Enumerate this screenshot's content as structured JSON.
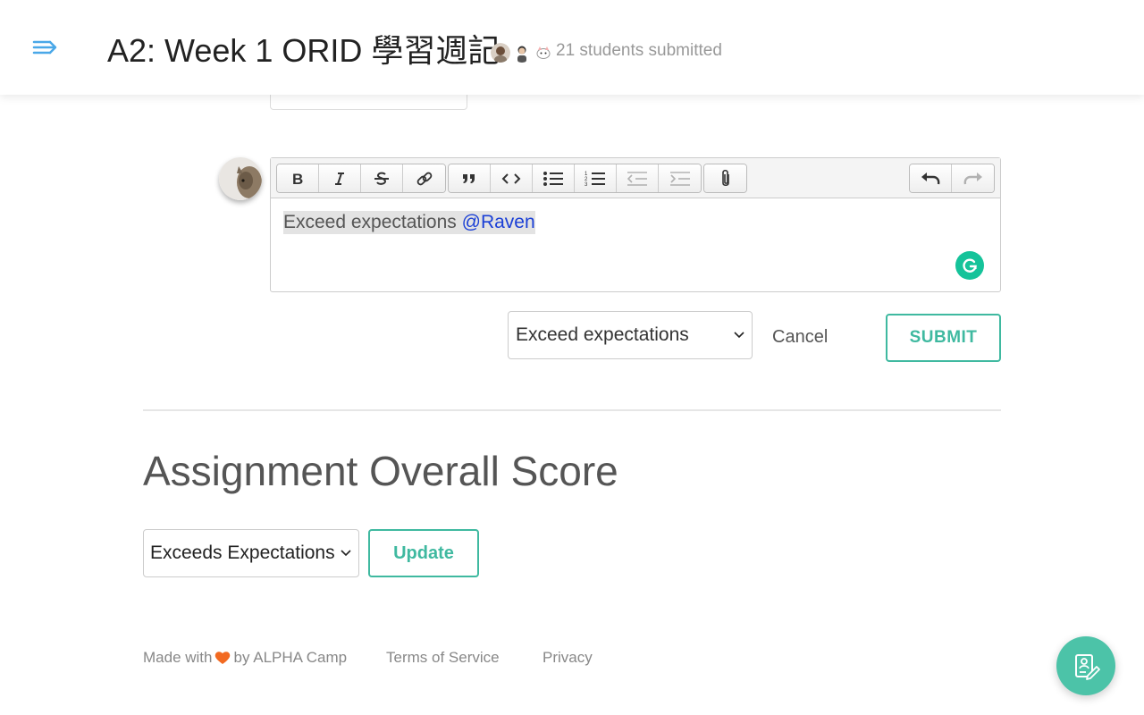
{
  "header": {
    "title": "A2: Week 1 ORID 學習週記",
    "submitted_text": "21 students submitted",
    "menu_icon": "menu-expand-icon"
  },
  "editor": {
    "content_text": "Exceed expectations",
    "mention": "@Raven",
    "toolbar": {
      "groups": [
        [
          "bold-icon",
          "italic-icon",
          "strikethrough-icon",
          "link-icon"
        ],
        [
          "quote-icon",
          "code-icon",
          "bullet-list-icon",
          "numbered-list-icon",
          "outdent-icon",
          "indent-icon"
        ],
        [
          "attach-icon"
        ],
        [
          "undo-icon",
          "redo-icon"
        ]
      ]
    }
  },
  "comment_form": {
    "rating_selected": "Exceed expectations",
    "cancel_label": "Cancel",
    "submit_label": "SUBMIT"
  },
  "overall": {
    "title": "Assignment Overall Score",
    "score_selected": "Exceeds Expectations",
    "update_label": "Update"
  },
  "footer": {
    "made_with": "Made with",
    "by": "by ALPHA Camp",
    "terms": "Terms of Service",
    "privacy": "Privacy"
  },
  "colors": {
    "accent": "#3fb9a0",
    "mention": "#1a3fd6",
    "heart": "#f26a21",
    "menu_icon": "#4aa8e8"
  }
}
